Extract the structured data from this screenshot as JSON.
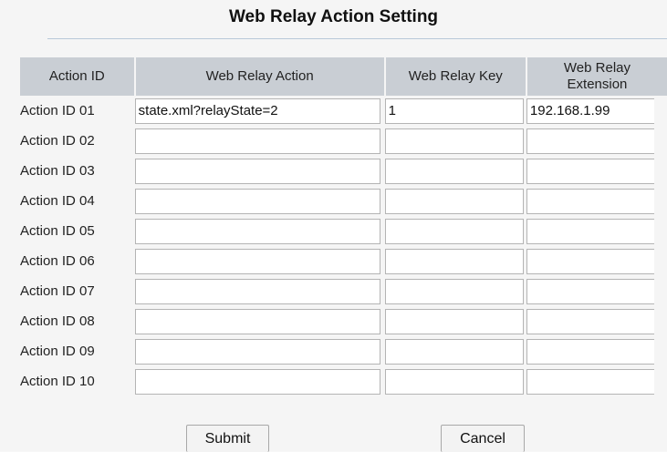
{
  "panel": {
    "title": "Web Relay Action Setting"
  },
  "table": {
    "headers": {
      "action_id": "Action ID",
      "web_relay_action": "Web Relay Action",
      "web_relay_key": "Web Relay Key",
      "web_relay_extension_line1": "Web Relay",
      "web_relay_extension_line2": "Extension"
    },
    "rows": [
      {
        "id": "Action ID 01",
        "action": "state.xml?relayState=2",
        "key": "1",
        "extension": "192.168.1.99"
      },
      {
        "id": "Action ID 02",
        "action": "",
        "key": "",
        "extension": ""
      },
      {
        "id": "Action ID 03",
        "action": "",
        "key": "",
        "extension": ""
      },
      {
        "id": "Action ID 04",
        "action": "",
        "key": "",
        "extension": ""
      },
      {
        "id": "Action ID 05",
        "action": "",
        "key": "",
        "extension": ""
      },
      {
        "id": "Action ID 06",
        "action": "",
        "key": "",
        "extension": ""
      },
      {
        "id": "Action ID 07",
        "action": "",
        "key": "",
        "extension": ""
      },
      {
        "id": "Action ID 08",
        "action": "",
        "key": "",
        "extension": ""
      },
      {
        "id": "Action ID 09",
        "action": "",
        "key": "",
        "extension": ""
      },
      {
        "id": "Action ID 10",
        "action": "",
        "key": "",
        "extension": ""
      }
    ]
  },
  "buttons": {
    "submit": "Submit",
    "cancel": "Cancel"
  }
}
